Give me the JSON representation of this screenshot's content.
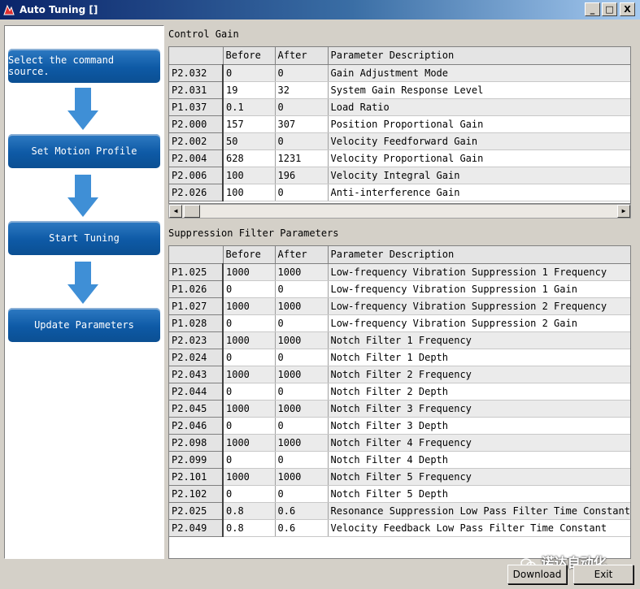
{
  "window": {
    "title": "Auto Tuning []",
    "minimize_glyph": "_",
    "maximize_glyph": "□",
    "close_glyph": "X"
  },
  "steps": [
    {
      "label": "Select the command source."
    },
    {
      "label": "Set Motion Profile"
    },
    {
      "label": "Start Tuning"
    },
    {
      "label": "Update Parameters"
    }
  ],
  "control_gain": {
    "caption": "Control Gain",
    "columns": [
      "",
      "Before",
      "After",
      "Parameter Description"
    ],
    "rows": [
      [
        "P2.032",
        "0",
        "0",
        "Gain Adjustment Mode"
      ],
      [
        "P2.031",
        "19",
        "32",
        "System Gain Response Level"
      ],
      [
        "P1.037",
        "0.1",
        "0",
        "Load Ratio"
      ],
      [
        "P2.000",
        "157",
        "307",
        "Position Proportional Gain"
      ],
      [
        "P2.002",
        "50",
        "0",
        "Velocity Feedforward Gain"
      ],
      [
        "P2.004",
        "628",
        "1231",
        "Velocity Proportional Gain"
      ],
      [
        "P2.006",
        "100",
        "196",
        "Velocity Integral Gain"
      ],
      [
        "P2.026",
        "100",
        "0",
        "Anti-interference Gain"
      ]
    ]
  },
  "suppression_filter": {
    "caption": "Suppression Filter Parameters",
    "columns": [
      "",
      "Before",
      "After",
      "Parameter Description"
    ],
    "rows": [
      [
        "P1.025",
        "1000",
        "1000",
        "Low-frequency Vibration Suppression 1 Frequency"
      ],
      [
        "P1.026",
        "0",
        "0",
        "Low-frequency Vibration Suppression 1 Gain"
      ],
      [
        "P1.027",
        "1000",
        "1000",
        "Low-frequency Vibration Suppression 2 Frequency"
      ],
      [
        "P1.028",
        "0",
        "0",
        "Low-frequency Vibration Suppression 2 Gain"
      ],
      [
        "P2.023",
        "1000",
        "1000",
        "Notch Filter 1 Frequency"
      ],
      [
        "P2.024",
        "0",
        "0",
        "Notch Filter 1 Depth"
      ],
      [
        "P2.043",
        "1000",
        "1000",
        "Notch Filter 2 Frequency"
      ],
      [
        "P2.044",
        "0",
        "0",
        "Notch Filter 2 Depth"
      ],
      [
        "P2.045",
        "1000",
        "1000",
        "Notch Filter 3 Frequency"
      ],
      [
        "P2.046",
        "0",
        "0",
        "Notch Filter 3 Depth"
      ],
      [
        "P2.098",
        "1000",
        "1000",
        "Notch Filter 4 Frequency"
      ],
      [
        "P2.099",
        "0",
        "0",
        "Notch Filter 4 Depth"
      ],
      [
        "P2.101",
        "1000",
        "1000",
        "Notch Filter 5 Frequency"
      ],
      [
        "P2.102",
        "0",
        "0",
        "Notch Filter 5 Depth"
      ],
      [
        "P2.025",
        "0.8",
        "0.6",
        "Resonance Suppression Low Pass Filter Time Constant"
      ],
      [
        "P2.049",
        "0.8",
        "0.6",
        "Velocity Feedback Low Pass Filter Time Constant"
      ]
    ]
  },
  "buttons": {
    "download": "Download",
    "exit": "Exit"
  },
  "watermark": "诺达自动化",
  "colors": {
    "step_button": "#0e5aa6",
    "arrow": "#3f8fd6",
    "title_bar": "#0a246a"
  }
}
